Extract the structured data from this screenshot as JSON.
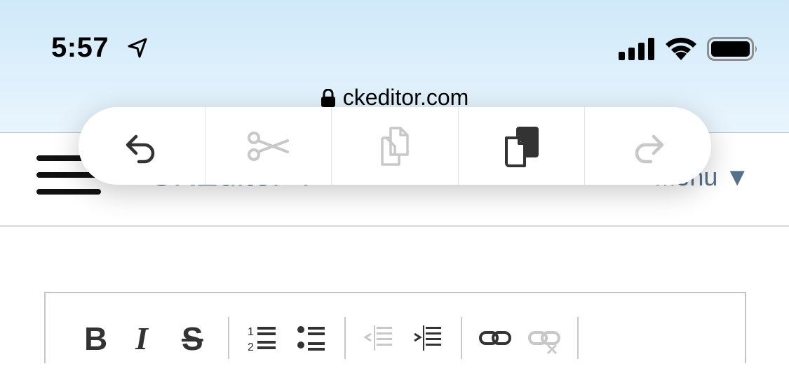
{
  "status_bar": {
    "time": "5:57",
    "location_icon": "location-arrow-icon",
    "signal_icon": "cellular-signal-icon",
    "wifi_icon": "wifi-icon",
    "battery_icon": "battery-icon"
  },
  "browser": {
    "url": "ckeditor.com",
    "lock_icon": "lock-icon"
  },
  "header": {
    "title": "CKEditor 4",
    "menu_label": "Menu ▼"
  },
  "context_menu": {
    "items": [
      {
        "icon": "undo-icon",
        "enabled": true
      },
      {
        "icon": "cut-icon",
        "enabled": false
      },
      {
        "icon": "copy-icon",
        "enabled": false
      },
      {
        "icon": "paste-icon",
        "enabled": true
      },
      {
        "icon": "redo-icon",
        "enabled": false
      }
    ]
  },
  "editor_toolbar": {
    "bold_label": "B",
    "italic_label": "I",
    "strike_label": "S",
    "buttons": [
      {
        "icon": "bold-icon",
        "enabled": true
      },
      {
        "icon": "italic-icon",
        "enabled": true
      },
      {
        "icon": "strikethrough-icon",
        "enabled": true
      },
      {
        "icon": "numbered-list-icon",
        "enabled": true
      },
      {
        "icon": "bulleted-list-icon",
        "enabled": true
      },
      {
        "icon": "decrease-indent-icon",
        "enabled": false
      },
      {
        "icon": "increase-indent-icon",
        "enabled": true
      },
      {
        "icon": "link-icon",
        "enabled": true
      },
      {
        "icon": "unlink-icon",
        "enabled": false
      }
    ]
  },
  "colors": {
    "enabled_icon": "#333333",
    "disabled_icon": "#c8c8c8",
    "header_text": "#56708a"
  }
}
